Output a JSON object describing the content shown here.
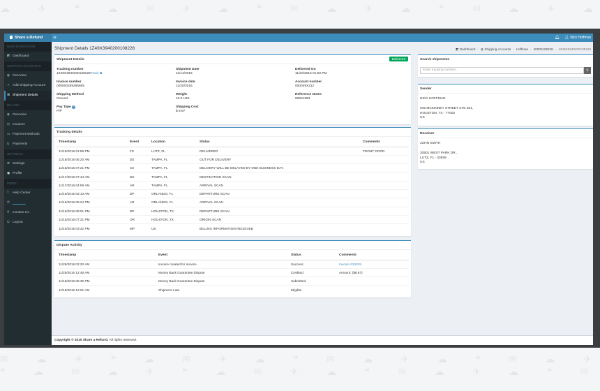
{
  "app": {
    "title": "Share a Refund",
    "user_name": "Nick Hoffman"
  },
  "sidebar": {
    "sections": [
      {
        "header": "MAIN NAVIGATION",
        "items": [
          {
            "label": "Dashboard",
            "icon": "dashboard-icon"
          }
        ]
      },
      {
        "header": "SHIPPING ACCOUNTS",
        "items": [
          {
            "label": "Overview",
            "icon": "globe-icon"
          },
          {
            "label": "Add Shipping Account",
            "icon": "plus-icon"
          },
          {
            "label": "Shipment Details",
            "icon": "list-icon",
            "active": true
          }
        ]
      },
      {
        "header": "BILLING",
        "items": [
          {
            "label": "Overview",
            "icon": "globe-icon"
          },
          {
            "label": "Invoices",
            "icon": "clock-icon"
          },
          {
            "label": "Payment Methods",
            "icon": "credit-card-icon"
          },
          {
            "label": "Payments",
            "icon": "dollar-icon"
          }
        ]
      },
      {
        "header": "SETTINGS",
        "items": [
          {
            "label": "Settings",
            "icon": "gear-icon"
          },
          {
            "label": "Profile",
            "icon": "user-icon"
          }
        ]
      },
      {
        "header": "MORE",
        "items": [
          {
            "label": "Help Center",
            "icon": "question-icon"
          },
          {
            "label": "",
            "icon": "phone-icon",
            "link": true
          },
          {
            "label": "Contact Us",
            "icon": "map-marker-icon"
          },
          {
            "label": "Logout",
            "icon": "logout-icon"
          }
        ]
      }
    ]
  },
  "page": {
    "title": "Shipment Details 1Z49X3940200108228",
    "breadcrumb": [
      "Dashboard",
      "Shipping Accounts",
      "Hoffman",
      "20000108228",
      "1Z49X3940200108228"
    ]
  },
  "shipment": {
    "title": "Shipment Details",
    "status": "Delivered",
    "tracking_number_label": "Tracking number",
    "tracking_number": "1Z49X3940200108228",
    "track_link": "Track",
    "invoice_number_label": "Invoice number",
    "invoice_number": "000000289295665",
    "shipping_method_label": "Shipping Method",
    "shipping_method": "Ground",
    "pay_type_label": "Pay Type",
    "pay_type": "P/P",
    "shipment_date_label": "Shipment Date",
    "shipment_date": "11/14/2016",
    "invoice_date_label": "Invoice date",
    "invoice_date": "11/20/2016",
    "weight_label": "Weight",
    "weight": "10.0 LBS",
    "shipping_cost_label": "Shipping Cost",
    "shipping_cost": "$ 8.67",
    "delivered_on_label": "Delivered On",
    "delivered_on": "11/20/2016 01:50 PM",
    "account_number_label": "Account number",
    "account_number": "000049X212",
    "reference_notes_label": "Reference Notes",
    "reference_notes": "60591983"
  },
  "tracking": {
    "title": "Tracking details",
    "columns": [
      "Timestamp",
      "Event",
      "Location",
      "Status",
      "Comments"
    ],
    "rows": [
      [
        "11/18/2016 01:58 PM",
        "FS",
        "LUTZ, FL",
        "DELIVERED",
        "FRONT DOOR"
      ],
      [
        "11/18/2016 06:20 AM",
        "DS",
        "TAMPA, FL",
        "OUT FOR DELIVERY",
        ""
      ],
      [
        "11/18/2016 07:21 PM",
        "C6",
        "TAMPA, FL",
        "DELIVERY WILL BE DELAYED BY ONE BUSINESS DAY.",
        ""
      ],
      [
        "11/17/2016 07:44 AM",
        "DS",
        "TAMPA, FL",
        "DESTINATION SCAN",
        ""
      ],
      [
        "11/17/2016 04:59 AM",
        "AR",
        "TAMPA, FL",
        "ARRIVAL SCAN",
        ""
      ],
      [
        "11/16/2016 02:13 AM",
        "DP",
        "ORLANDO, FL",
        "DEPARTURE SCAN",
        ""
      ],
      [
        "11/16/2016 05:24 PM",
        "AR",
        "ORLANDO, FL",
        "ARRIVAL SCAN",
        ""
      ],
      [
        "11/15/2016 09:01 PM",
        "DP",
        "HOUSTON, TX",
        "DEPARTURE SCAN",
        ""
      ],
      [
        "11/15/2016 07:21 PM",
        "OR",
        "HOUSTON, TX",
        "ORIGIN SCAN",
        ""
      ],
      [
        "11/15/2016 03:42 PM",
        "MP",
        "US",
        "BILLING INFORMATION RECEIVED",
        ""
      ]
    ]
  },
  "dispute": {
    "title": "Dispute Activity",
    "columns": [
      "Timestamp",
      "Event",
      "Status",
      "Comments"
    ],
    "rows": [
      [
        "11/25/2016 02:20 AM",
        "Invoice created for service",
        "Success",
        "Invoice #10019"
      ],
      [
        "11/25/2016 12:45 AM",
        "Money Back Guarantee Dispute",
        "Credited",
        "Amount: ($8.67)"
      ],
      [
        "11/18/2016 06:36 PM",
        "Money Back Guarantee Dispute",
        "Submitted",
        ""
      ],
      [
        "11/18/2016 12:01 AM",
        "Shipment Late",
        "Eligible",
        ""
      ]
    ]
  },
  "search": {
    "title": "Search shipments",
    "placeholder": "Enter tracking number..."
  },
  "sender": {
    "title": "Sender",
    "name": "NICK HOFFMAN",
    "address1": "945 MCKINNEY STREET STE 361,",
    "address2": "HOUSTON, TX - 77002",
    "country": "US"
  },
  "receiver": {
    "title": "Receiver",
    "name": "JOHN SMITH",
    "address1": "20501 WEST PARK DR ,",
    "address2": "LUTZ, FL - 33559",
    "country": "US"
  },
  "footer": {
    "copyright": "Copyright © 2015 Share a Refund.",
    "rights": "All rights reserved."
  },
  "colors": {
    "topbar": "#3c8dbc",
    "sidebar": "#222d32",
    "badge": "#00a65a",
    "link": "#3c8dbc"
  }
}
